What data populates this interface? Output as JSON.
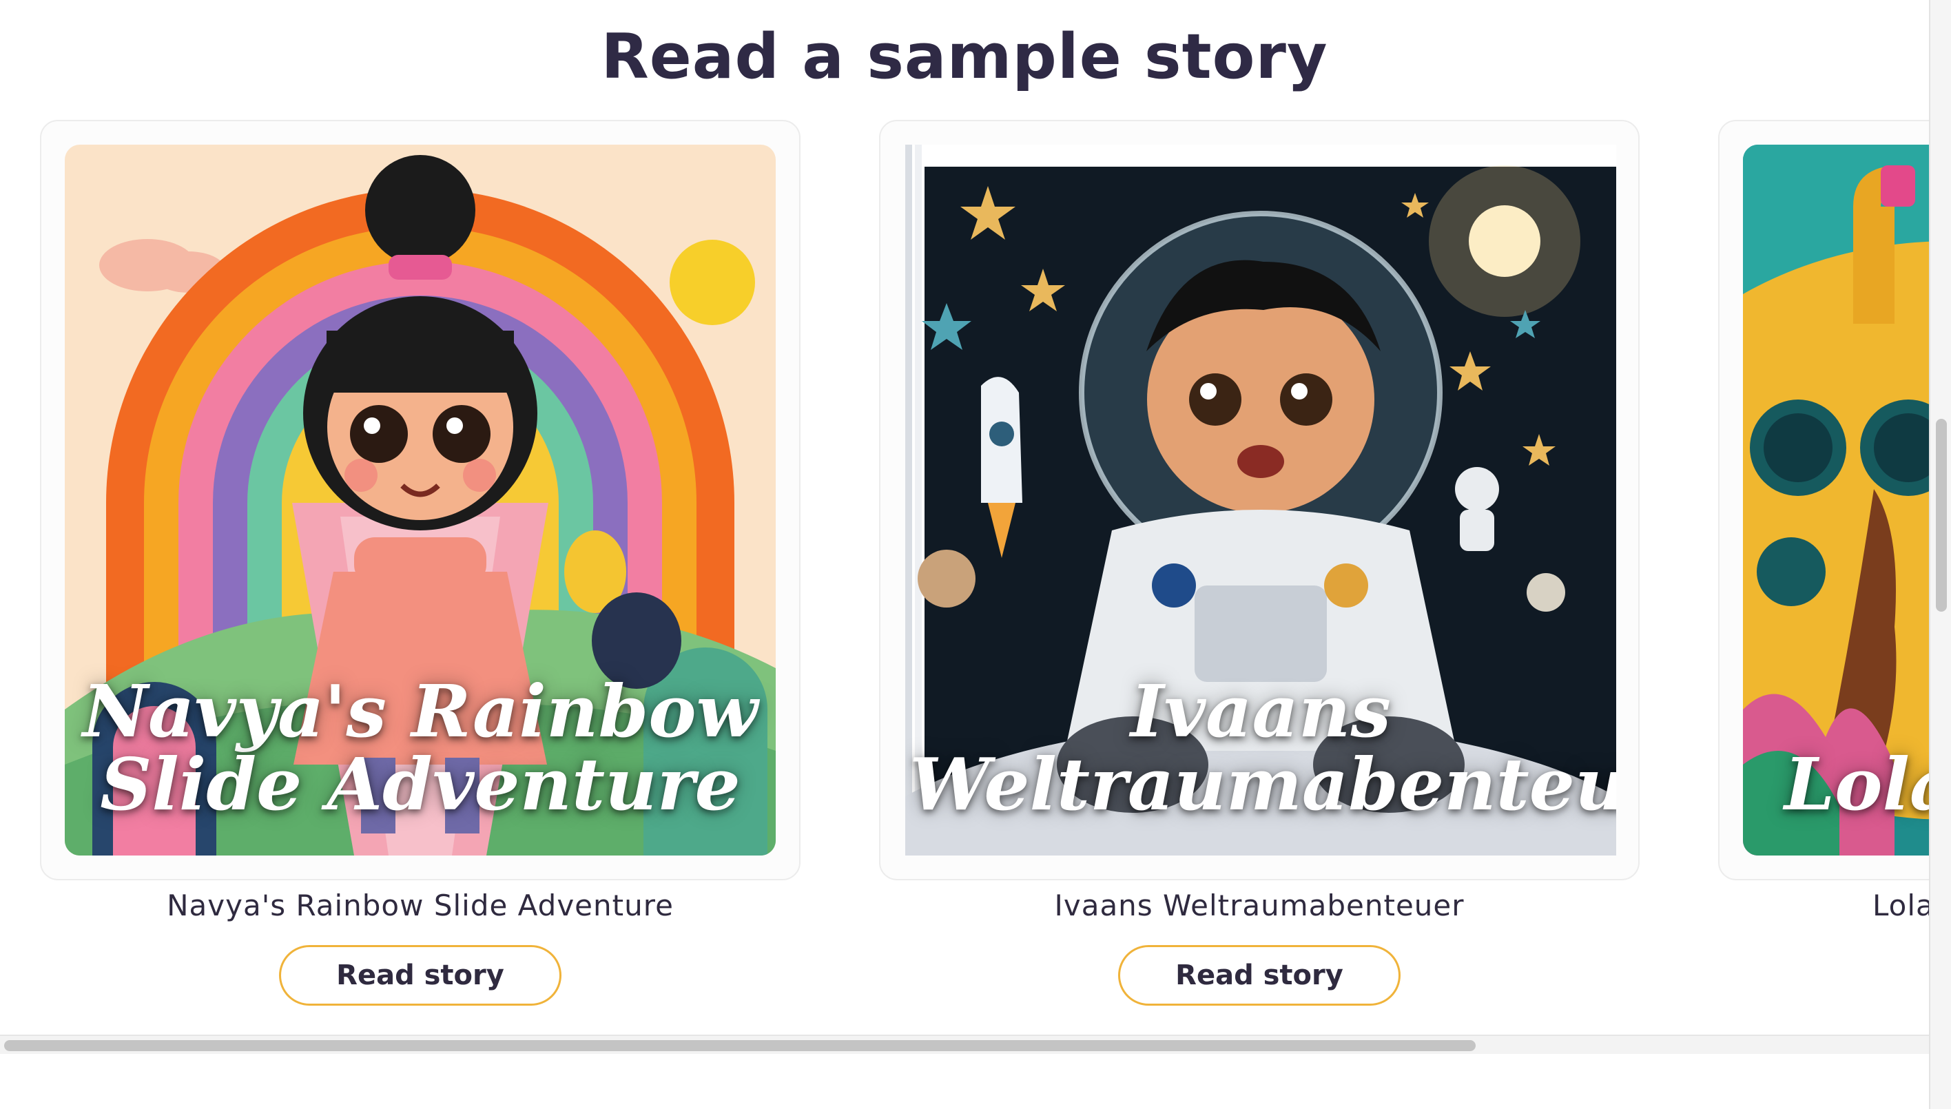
{
  "section": {
    "title": "Read a sample story"
  },
  "stories": [
    {
      "cover_title": "Navya's Rainbow Slide Adventure",
      "caption": "Navya's Rainbow Slide Adventure",
      "button_label": "Read story"
    },
    {
      "cover_title": "Ivaans Weltraumabenteuer",
      "caption": "Ivaans Weltraumabenteuer",
      "button_label": "Read story"
    },
    {
      "cover_title": "Lola",
      "caption": "Lola"
    }
  ],
  "colors": {
    "button_border": "#f0b33a",
    "title_text": "#2f2a45"
  }
}
